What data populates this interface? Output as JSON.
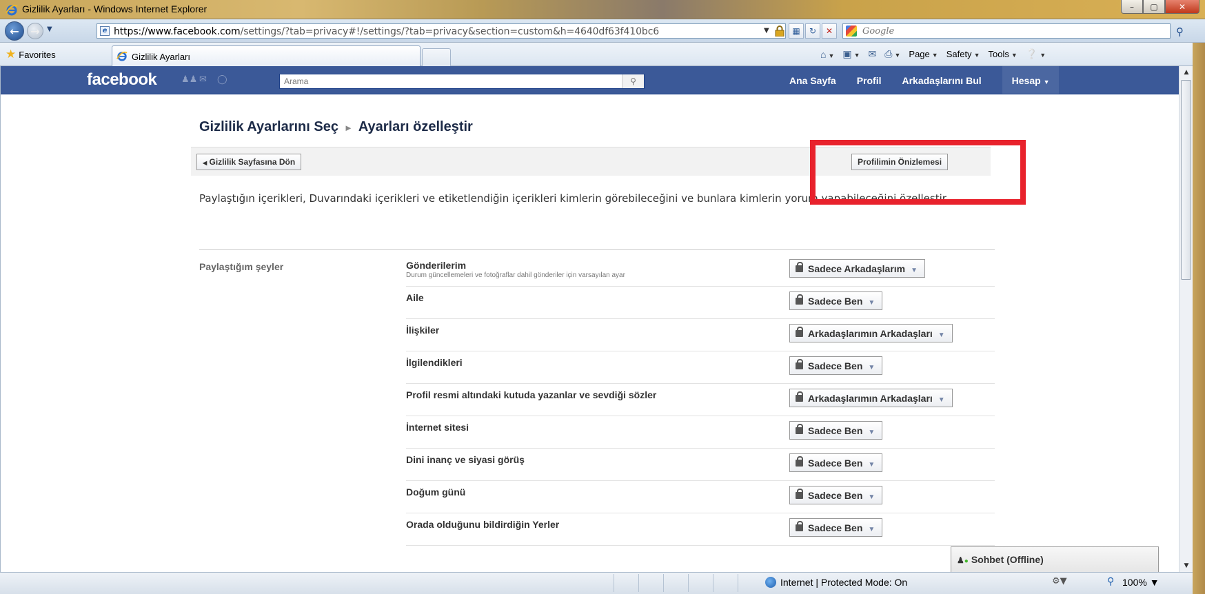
{
  "window": {
    "title": "Gizlilik Ayarları - Windows Internet Explorer",
    "min": "–",
    "max": "▢",
    "close": "✕"
  },
  "address": {
    "url_host": "https://www.facebook.com",
    "url_path": "/settings/?tab=privacy#!/settings/?tab=privacy&section=custom&h=4640df63f410bc6",
    "search_placeholder": "Google"
  },
  "favorites": {
    "label": "Favorites",
    "tab_label": "Gizlilik Ayarları"
  },
  "commands": {
    "page": "Page",
    "safety": "Safety",
    "tools": "Tools"
  },
  "facebook": {
    "logo": "facebook",
    "search_placeholder": "Arama",
    "nav": {
      "home": "Ana Sayfa",
      "profile": "Profil",
      "find_friends": "Arkadaşlarını Bul",
      "account": "Hesap"
    },
    "breadcrumb": {
      "parent": "Gizlilik Ayarlarını Seç",
      "current": "Ayarları özelleştir"
    },
    "back_button": "Gizlilik Sayfasına Dön",
    "preview_button": "Profilimin Önizlemesi",
    "intro": "Paylaştığın içerikleri, Duvarındaki içerikleri ve etiketlendiğin içerikleri kimlerin görebileceğini ve bunlara kimlerin yorum yapabileceğini özelleştir.",
    "section_label": "Paylaştığım şeyler",
    "rows": [
      {
        "name": "Gönderilerim",
        "sub": "Durum güncellemeleri ve fotoğraflar dahil gönderiler için varsayılan ayar",
        "value": "Sadece Arkadaşlarım"
      },
      {
        "name": "Aile",
        "sub": "",
        "value": "Sadece Ben"
      },
      {
        "name": "İlişkiler",
        "sub": "",
        "value": "Arkadaşlarımın Arkadaşları"
      },
      {
        "name": "İlgilendikleri",
        "sub": "",
        "value": "Sadece Ben"
      },
      {
        "name": "Profil resmi altındaki kutuda yazanlar ve sevdiği sözler",
        "sub": "",
        "value": "Arkadaşlarımın Arkadaşları"
      },
      {
        "name": "İnternet sitesi",
        "sub": "",
        "value": "Sadece Ben"
      },
      {
        "name": "Dini inanç ve siyasi görüş",
        "sub": "",
        "value": "Sadece Ben"
      },
      {
        "name": "Doğum günü",
        "sub": "",
        "value": "Sadece Ben"
      },
      {
        "name": "Orada olduğunu bildirdiğin Yerler",
        "sub": "",
        "value": "Sadece Ben"
      }
    ],
    "chat": "Sohbet (Offline)"
  },
  "status": {
    "zone": "Internet | Protected Mode: On",
    "zoom": "100%"
  },
  "colors": {
    "fb_blue": "#3b5998",
    "highlight_red": "#e8222c"
  }
}
